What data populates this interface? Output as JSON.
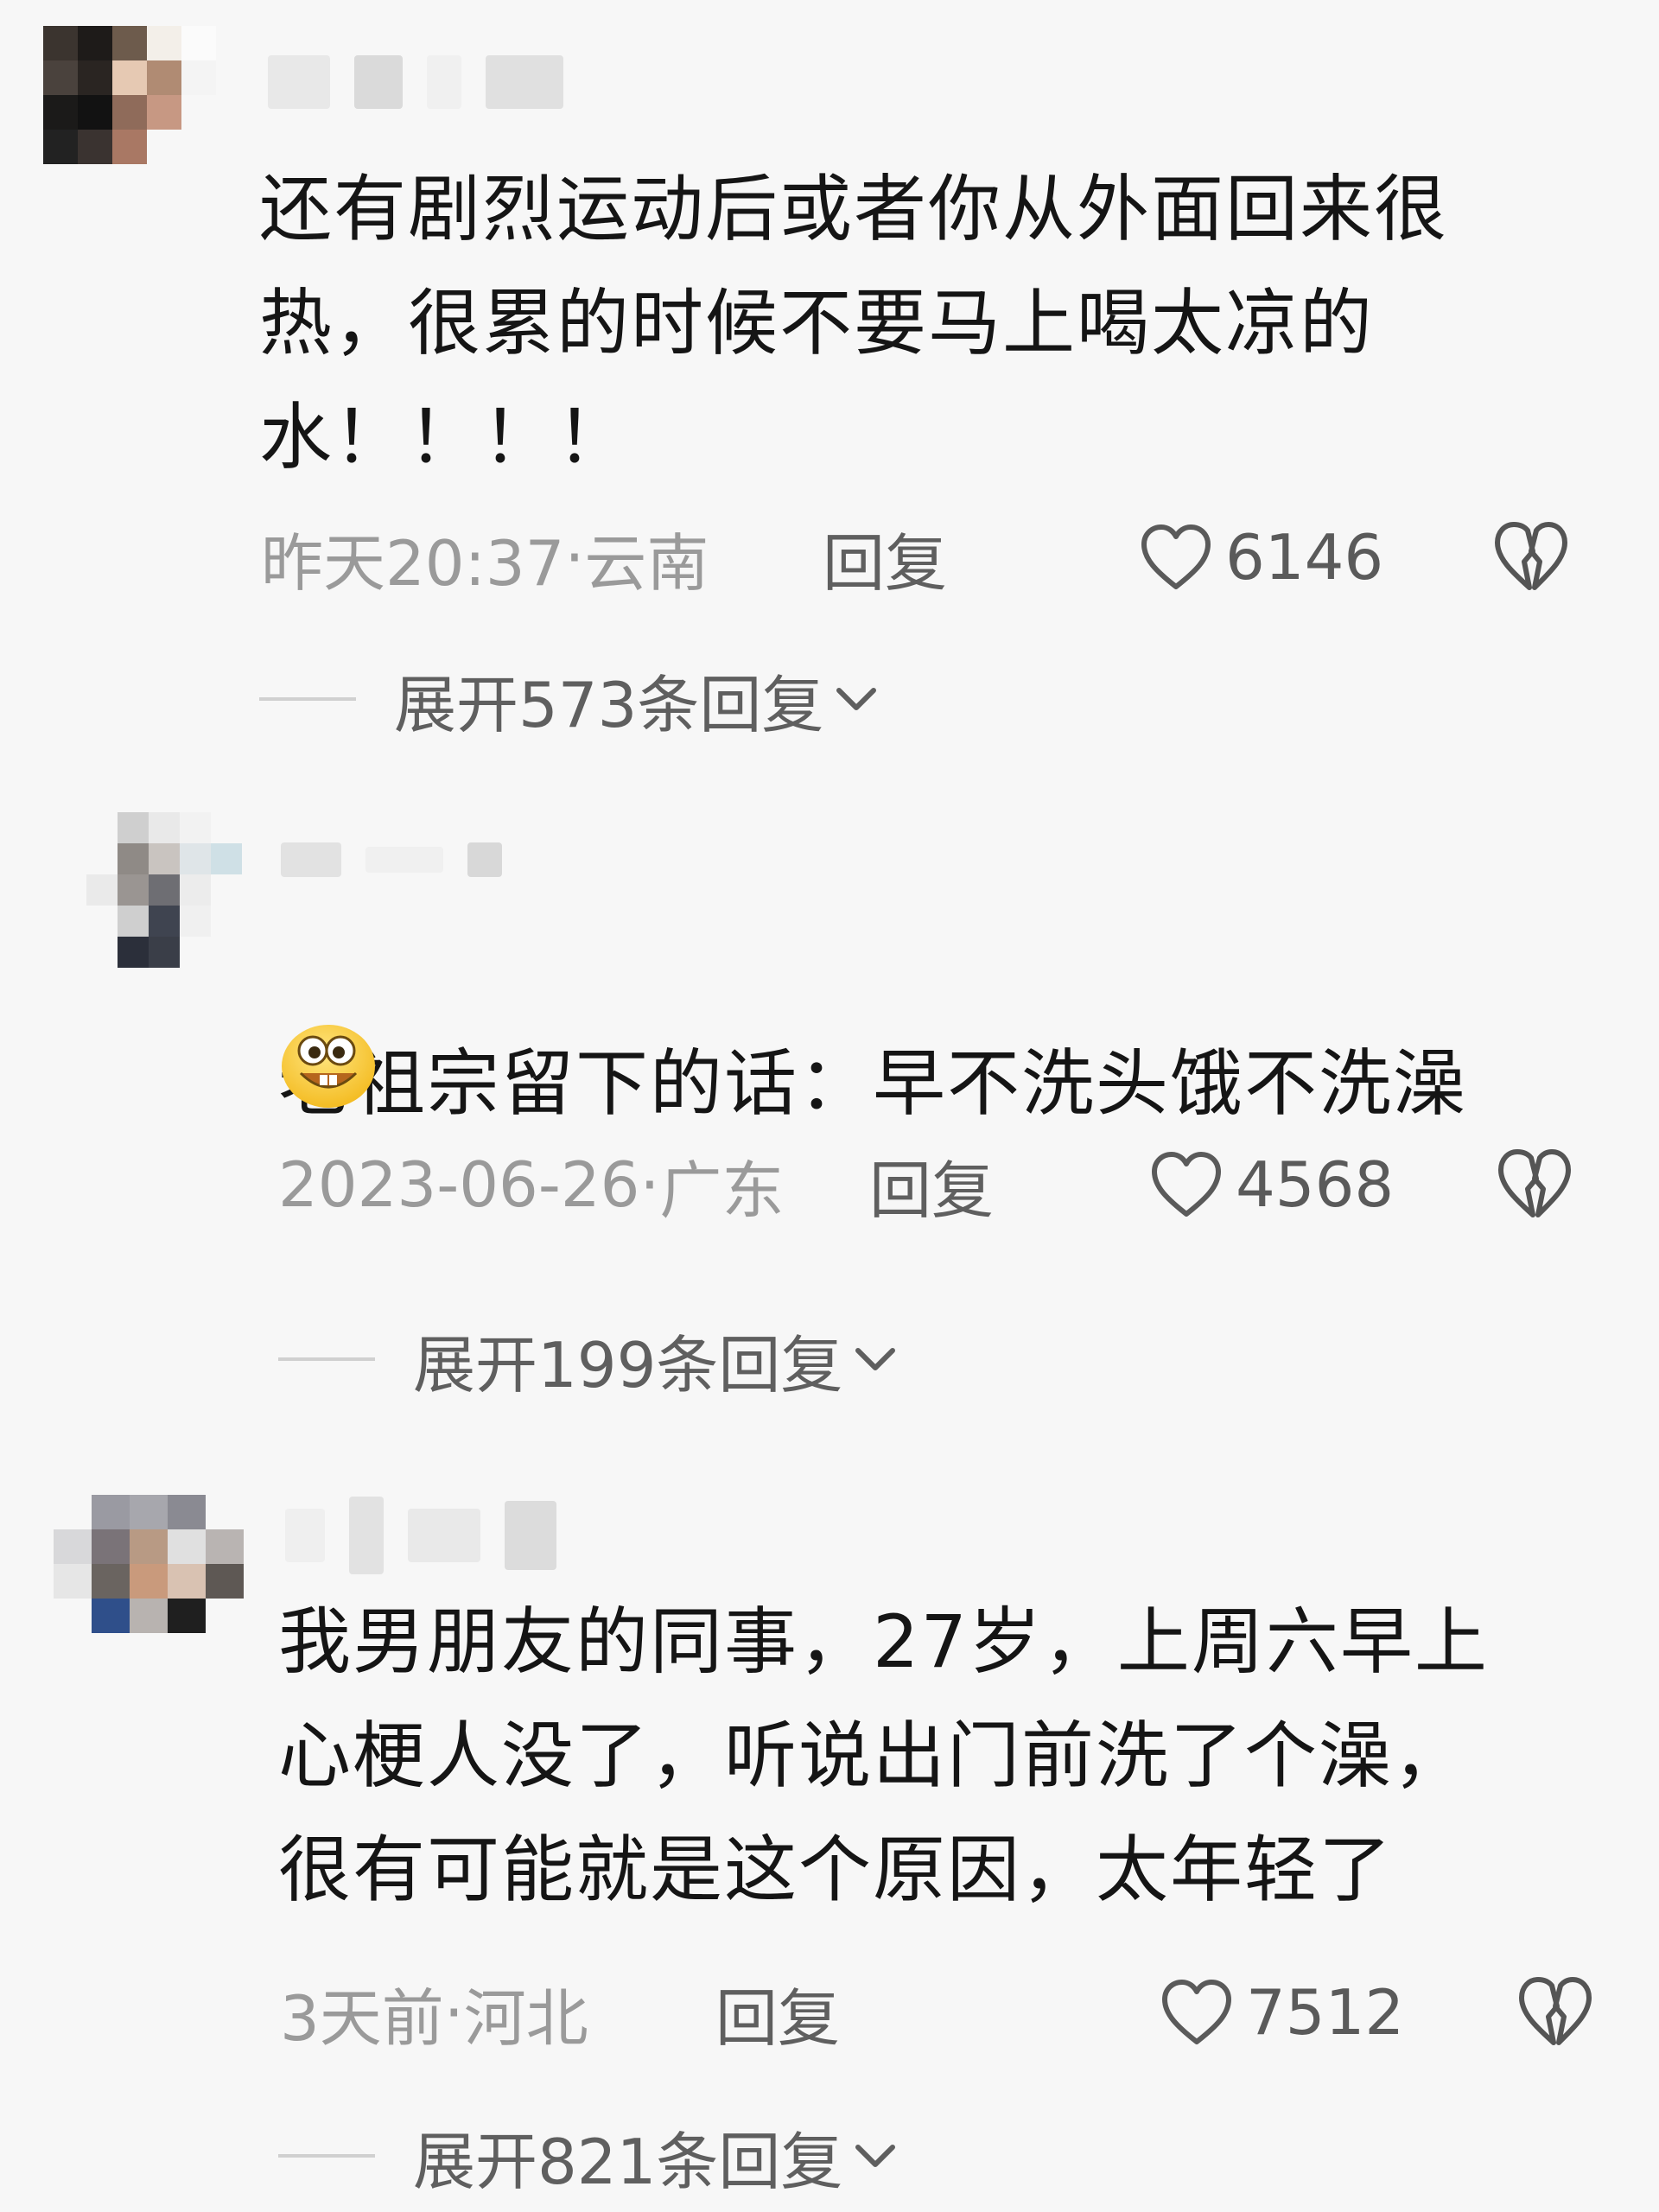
{
  "comments": [
    {
      "text": "还有剧烈运动后或者你从外面回来很\n热，很累的时候不要马上喝太凉的\n水！！！！",
      "time": "昨天20:37",
      "region": "云南",
      "reply_label": "回复",
      "likes": "6146",
      "expand_label": "展开573条回复"
    },
    {
      "text": "老祖宗留下的话：早不洗头饿不洗澡",
      "time": "2023-06-26",
      "region": "广东",
      "reply_label": "回复",
      "likes": "4568",
      "expand_label": "展开199条回复"
    },
    {
      "text": "我男朋友的同事，27岁，上周六早上\n心梗人没了，听说出门前洗了个澡，\n很有可能就是这个原因，太年轻了",
      "time": "3天前",
      "region": "河北",
      "reply_label": "回复",
      "likes": "7512",
      "expand_label": "展开821条回复"
    }
  ],
  "separator": " · ",
  "icons": {
    "like": "heart-outline-icon",
    "dislike": "broken-heart-icon",
    "expand": "chevron-down-icon",
    "emoji": "grinning-face-emoji"
  },
  "colors": {
    "text": "#151515",
    "meta": "#9a9a9a",
    "action": "#5f5f5f"
  }
}
